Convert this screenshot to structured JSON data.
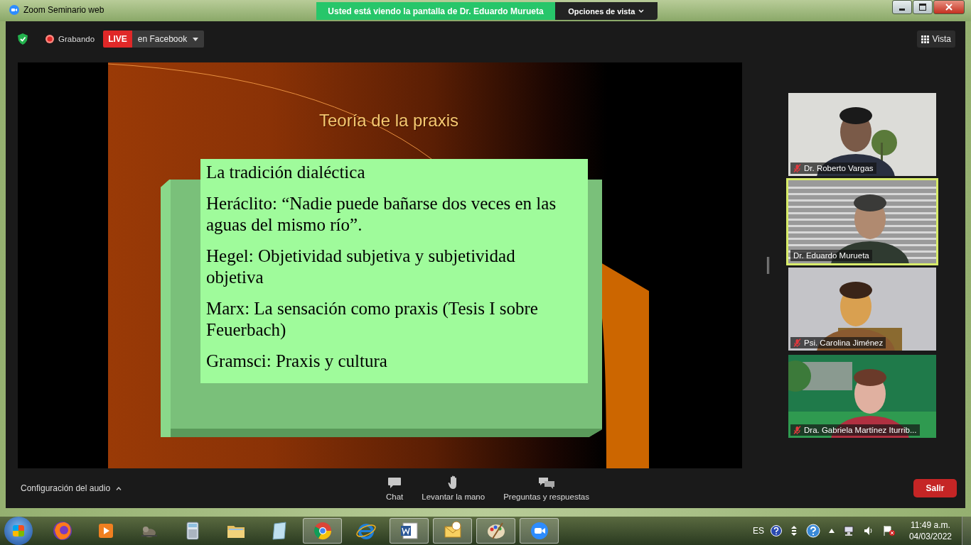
{
  "window": {
    "title": "Zoom Seminario web"
  },
  "share_banner": {
    "text": "Usted está viendo la pantalla de Dr. Eduardo Murueta",
    "options": "Opciones de vista"
  },
  "top_bar": {
    "recording": "Grabando",
    "live": "LIVE",
    "live_target": "en Facebook",
    "view": "Vista"
  },
  "slide": {
    "title": "Teoría de la praxis",
    "points": [
      "La tradición dialéctica",
      "Heráclito: “Nadie puede bañarse dos veces en las aguas del mismo río”.",
      "Hegel: Objetividad subjetiva y subjetividad objetiva",
      "Marx: La sensación como praxis (Tesis I sobre Feuerbach)",
      "Gramsci:  Praxis y cultura"
    ]
  },
  "gallery": [
    {
      "name": "Dr. Roberto Vargas",
      "muted": true,
      "speaking": false
    },
    {
      "name": "Dr. Eduardo Murueta",
      "muted": false,
      "speaking": true
    },
    {
      "name": "Psi. Carolina Jiménez",
      "muted": true,
      "speaking": false
    },
    {
      "name": "Dra. Gabriela Martínez Iturrib...",
      "muted": true,
      "speaking": false
    }
  ],
  "bottom_bar": {
    "audio": "Configuración del audio",
    "actions": [
      {
        "kind": "chat",
        "label": "Chat"
      },
      {
        "kind": "hand",
        "label": "Levantar la mano"
      },
      {
        "kind": "qa",
        "label": "Preguntas y respuestas"
      }
    ],
    "leave": "Salir"
  },
  "taskbar": {
    "apps": [
      {
        "kind": "fox",
        "open": false
      },
      {
        "kind": "player",
        "open": false
      },
      {
        "kind": "mascot",
        "open": false
      },
      {
        "kind": "calculator",
        "open": false
      },
      {
        "kind": "folder",
        "open": false
      },
      {
        "kind": "notepad",
        "open": false
      },
      {
        "kind": "chrome",
        "open": true
      },
      {
        "kind": "ie",
        "open": false
      },
      {
        "kind": "word",
        "open": true
      },
      {
        "kind": "outlook",
        "open": true
      },
      {
        "kind": "paint",
        "open": true
      },
      {
        "kind": "zoom",
        "open": true
      }
    ],
    "language": "ES",
    "time": "11:49 a.m.",
    "date": "04/03/2022"
  }
}
